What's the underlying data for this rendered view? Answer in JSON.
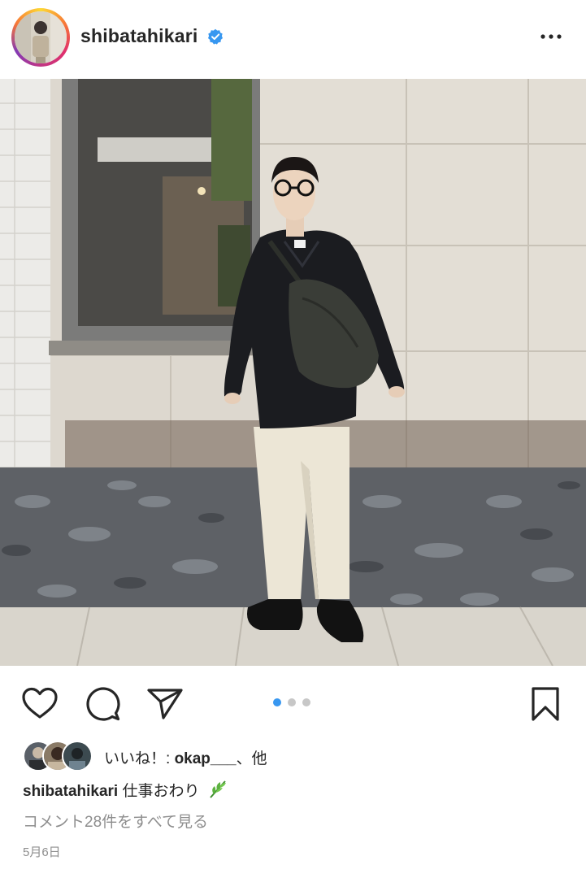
{
  "post": {
    "username": "shibatahikari",
    "verified": true,
    "accent_verified": "#3897f0",
    "more_icon": "more-horizontal-icon"
  },
  "photo": {
    "carousel_total": 3,
    "carousel_current": 1,
    "dot_active_color": "#3897f0",
    "dot_inactive_color": "#c7c7c7"
  },
  "actions": {
    "like_icon": "heart-icon",
    "comment_icon": "comment-bubble-icon",
    "share_icon": "paper-plane-icon",
    "save_icon": "bookmark-icon"
  },
  "likes": {
    "prefix": "いいね！: ",
    "user": "okap___",
    "suffix": "、他"
  },
  "caption": {
    "user": "shibatahikari",
    "text": "仕事おわり"
  },
  "comments": {
    "view_all_label": "コメント28件をすべて見る"
  },
  "date": "5月6日"
}
